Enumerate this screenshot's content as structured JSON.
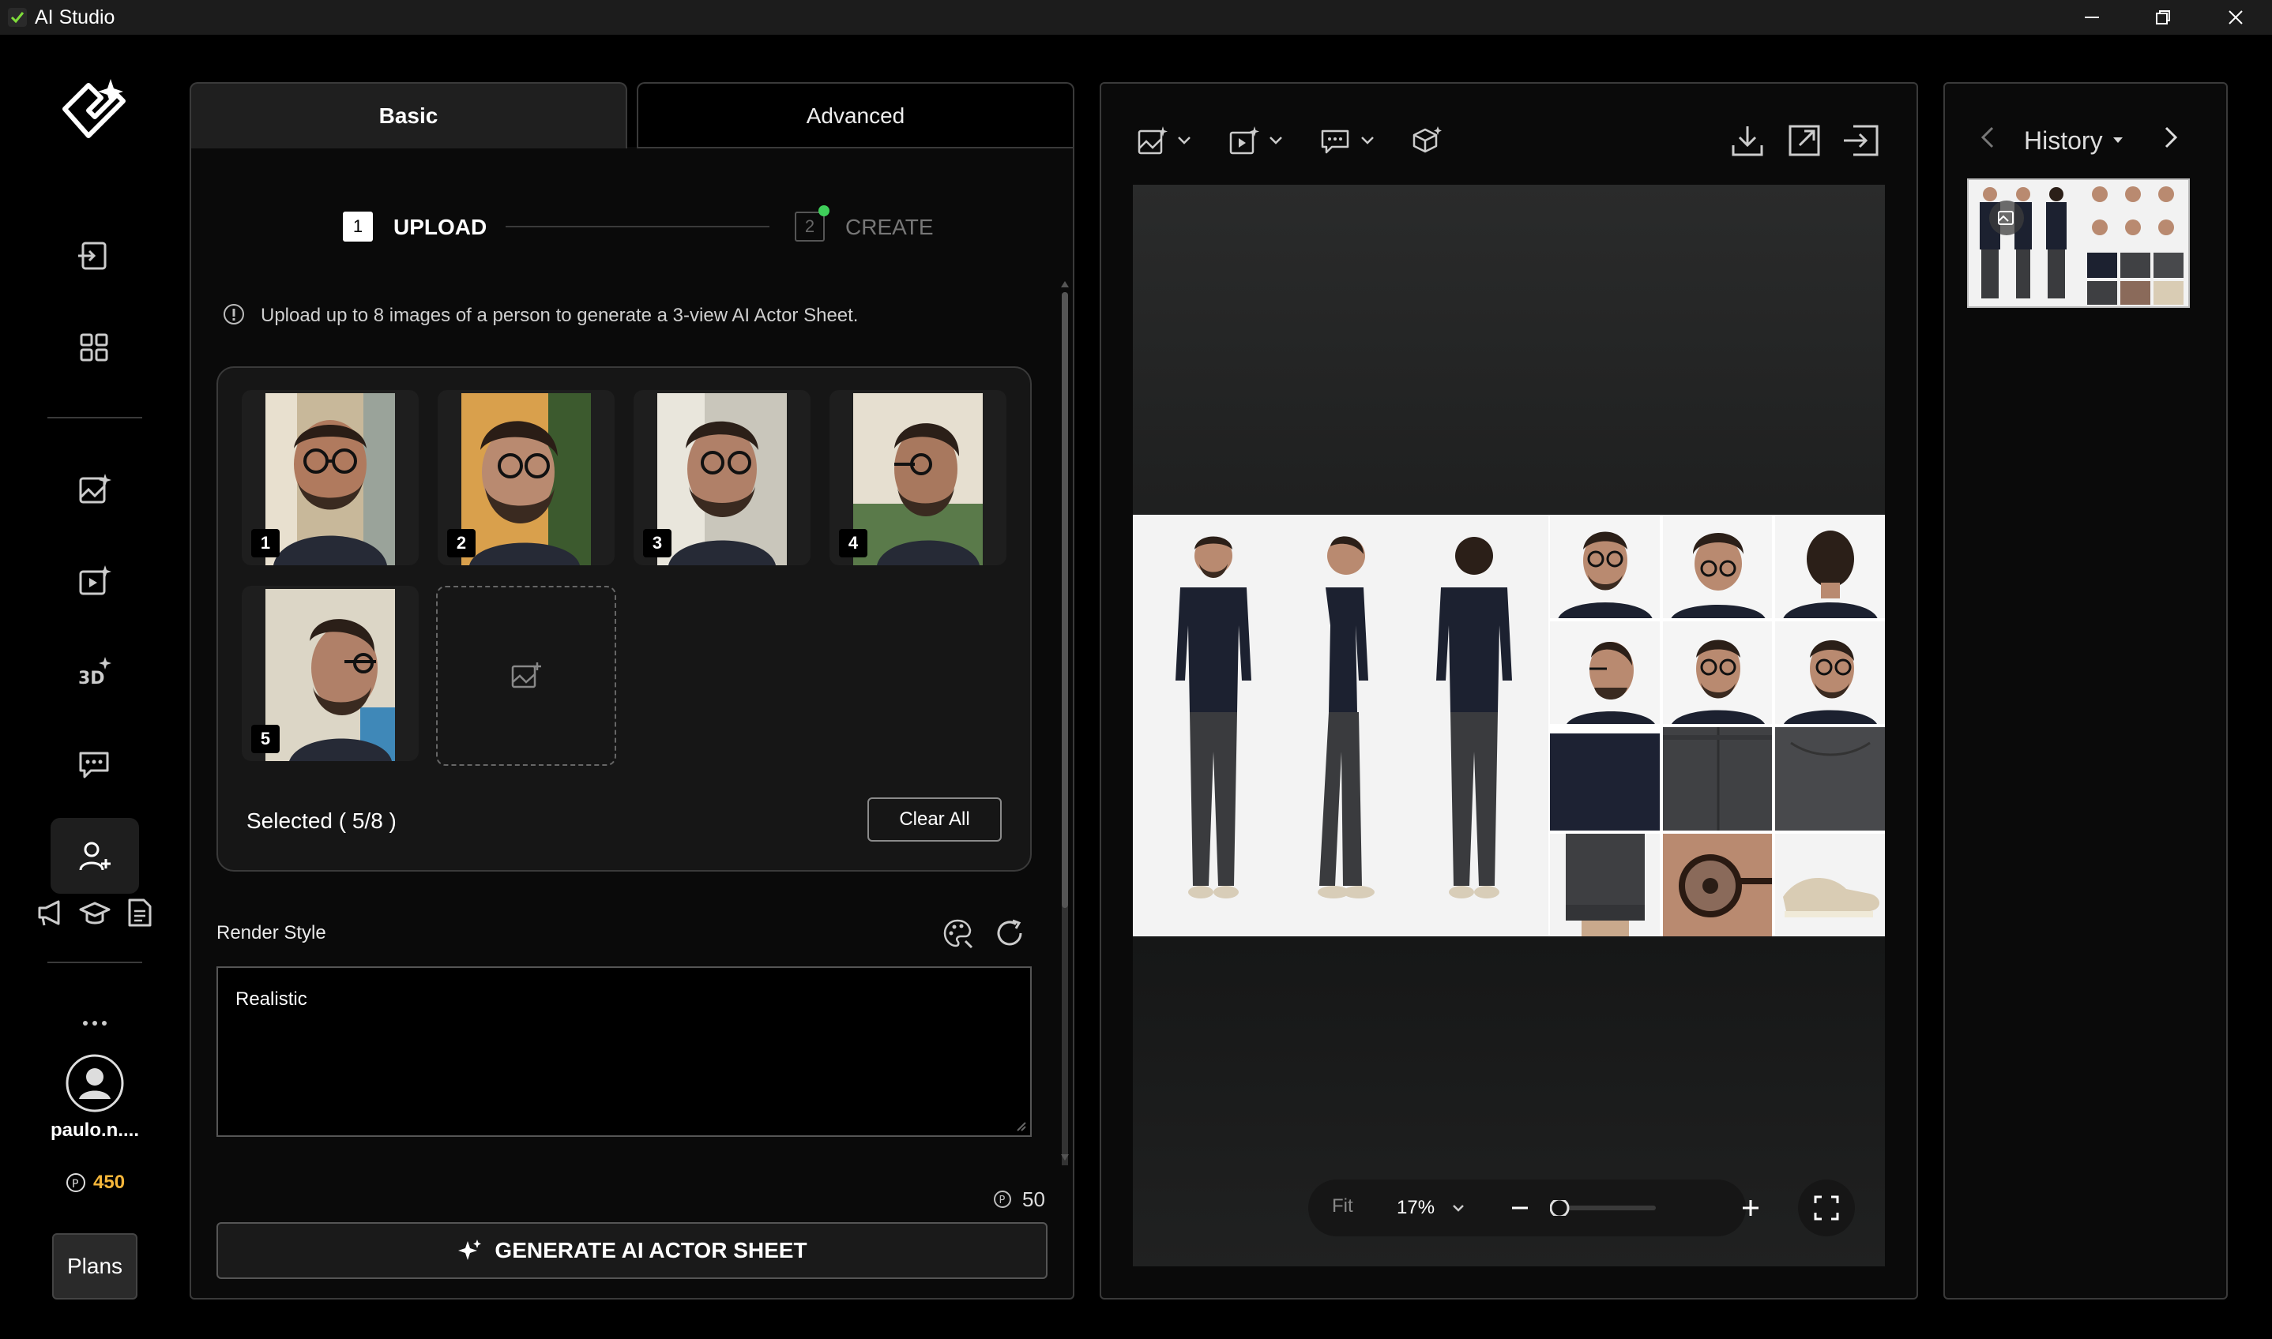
{
  "window": {
    "title": "AI Studio"
  },
  "user": {
    "name": "paulo.n....",
    "credits": "450"
  },
  "plans_label": "Plans",
  "tabs": {
    "basic": "Basic",
    "advanced": "Advanced"
  },
  "steps": {
    "step1_num": "1",
    "step1_label": "UPLOAD",
    "step2_num": "2",
    "step2_label": "CREATE"
  },
  "info_text": "Upload up to 8 images of a person to generate a 3-view AI Actor Sheet.",
  "uploads": [
    {
      "num": "1"
    },
    {
      "num": "2"
    },
    {
      "num": "3"
    },
    {
      "num": "4"
    },
    {
      "num": "5"
    }
  ],
  "selected_text": "Selected ( 5/8 )",
  "clear_all_label": "Clear All",
  "render_style": {
    "label": "Render Style",
    "value": "Realistic"
  },
  "cost": "50",
  "generate_label": "GENERATE AI ACTOR SHEET",
  "canvas": {
    "fit_label": "Fit",
    "zoom_value": "17%",
    "zoom_level": 0.17
  },
  "history": {
    "title": "History"
  },
  "icons": [
    "app-logo-icon",
    "import-icon",
    "grid-icon",
    "image-ai-icon",
    "video-ai-icon",
    "3d-ai-icon",
    "chat-icon",
    "actor-icon",
    "megaphone-icon",
    "graduation-cap-icon",
    "document-icon",
    "more-icon",
    "avatar-icon",
    "download-icon",
    "fullscreen-icon"
  ],
  "colors": {
    "accent": "#f5b63a",
    "status_dot": "#3fcf5a",
    "panel_border": "#3a3a3a"
  }
}
